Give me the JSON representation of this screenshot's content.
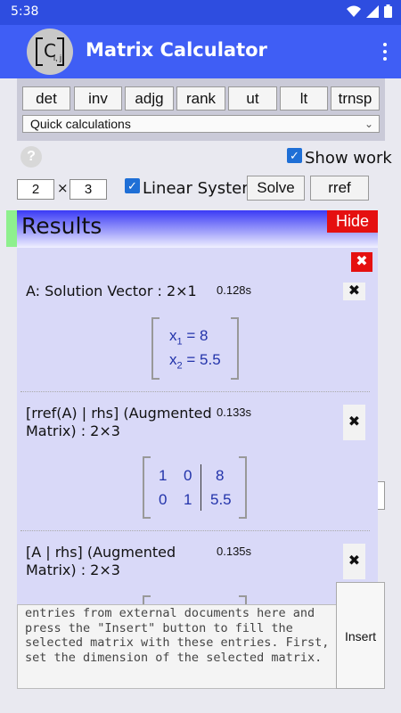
{
  "status": {
    "time": "5:38"
  },
  "app": {
    "title": "Matrix Calculator",
    "logo_letter": "C",
    "logo_sub": "i, j"
  },
  "functions": [
    "det",
    "inv",
    "adjg",
    "rank",
    "ut",
    "lt",
    "trnsp"
  ],
  "quick_select": {
    "value": "Quick calculations"
  },
  "help": "?",
  "show_work": {
    "label": "Show work",
    "checked": true
  },
  "dims": {
    "rows": "2",
    "times": "×",
    "cols": "3"
  },
  "linear_system": {
    "label": "Linear System",
    "checked": true
  },
  "buttons": {
    "solve": "Solve",
    "rref": "rref"
  },
  "results": {
    "title": "Results",
    "hide": "Hide",
    "close_all": "✖",
    "entries": [
      {
        "title": "A: Solution Vector : 2×1",
        "time": "0.128s",
        "rows": [
          [
            "x",
            "1",
            "= 8"
          ],
          [
            "x",
            "2",
            "= 5.5"
          ]
        ]
      },
      {
        "title": "[rref(A) | rhs] (Augmented Matrix) : 2×3",
        "time": "0.133s",
        "rows": [
          [
            "1",
            "0",
            "8"
          ],
          [
            "0",
            "1",
            "5.5"
          ]
        ]
      },
      {
        "title": "[A | rhs] (Augmented Matrix) : 2×3",
        "time": "0.135s"
      }
    ],
    "close_icon": "✖"
  },
  "paste": {
    "text": "entries from external documents here and press the \"Insert\" button to fill the selected matrix with these entries. First, set the dimension of the selected matrix.",
    "insert_label": "Insert"
  }
}
